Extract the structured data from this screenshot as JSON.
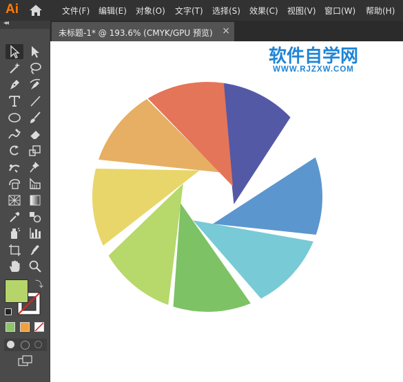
{
  "app": {
    "logo": "Ai"
  },
  "menu": {
    "items": [
      {
        "id": "file",
        "label": "文件(F)"
      },
      {
        "id": "edit",
        "label": "编辑(E)"
      },
      {
        "id": "object",
        "label": "对象(O)"
      },
      {
        "id": "type",
        "label": "文字(T)"
      },
      {
        "id": "select",
        "label": "选择(S)"
      },
      {
        "id": "effect",
        "label": "效果(C)"
      },
      {
        "id": "view",
        "label": "视图(V)"
      },
      {
        "id": "window",
        "label": "窗口(W)"
      },
      {
        "id": "help",
        "label": "帮助(H)"
      }
    ]
  },
  "document_tab": {
    "label": "未标题-1* @ 193.6% (CMYK/GPU 预览)",
    "close": "×"
  },
  "toolbar": {
    "collapse": "◂◂",
    "tools": [
      "selection-tool",
      "direct-selection-tool",
      "magic-wand-tool",
      "lasso-tool",
      "pen-tool",
      "curvature-tool",
      "type-tool",
      "line-segment-tool",
      "ellipse-tool",
      "paintbrush-tool",
      "shaper-tool",
      "eraser-tool",
      "rotate-tool",
      "scale-tool",
      "puppet-warp-tool",
      "pin-tool",
      "free-transform-tool",
      "shape-builder-tool",
      "perspective-grid-tool",
      "gradient-tool",
      "eyedropper-tool",
      "blend-tool",
      "symbol-sprayer-tool",
      "column-graph-tool",
      "artboard-tool",
      "slice-tool",
      "hand-tool",
      "zoom-tool"
    ],
    "fill_color": "#B5D56A",
    "stroke": "none",
    "swatch_colors": [
      "#8DC46B",
      "#F0A03C",
      "none"
    ]
  },
  "watermark": {
    "title": "软件自学网",
    "url": "WWW.RJZXW.COM",
    "color": "#1F84D6"
  },
  "artwork": {
    "shape": "camera-aperture-logo",
    "blade_colors": [
      "#5459A6",
      "#5B96CF",
      "#78CAD6",
      "#7DC265",
      "#B7D86A",
      "#E8D66A",
      "#E6AF63",
      "#E57558"
    ]
  }
}
